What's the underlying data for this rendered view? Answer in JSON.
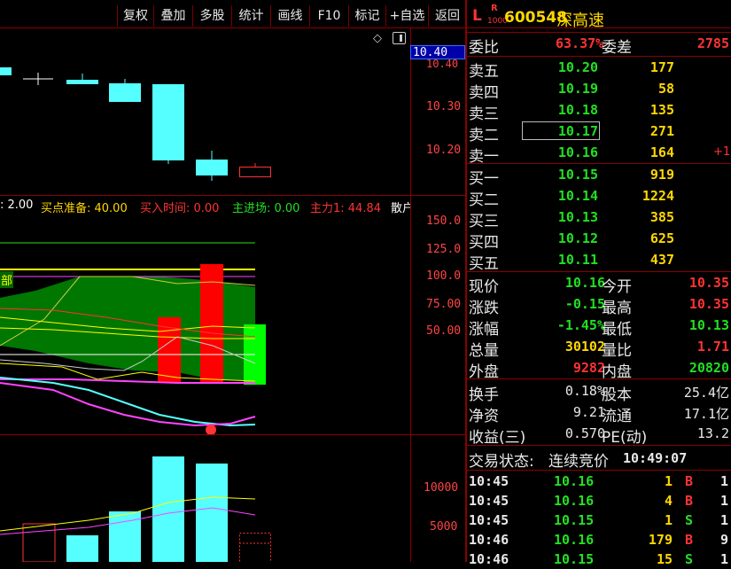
{
  "toolbar": [
    "复权",
    "叠加",
    "多股",
    "统计",
    "画线",
    "F10",
    "标记",
    "+自选",
    "返回"
  ],
  "price_axis": {
    "current": "10.40",
    "ticks": [
      "10.40",
      "10.30",
      "10.20"
    ]
  },
  "indicator_bar": [
    {
      "text": ": 2.00",
      "color": "#ffffff"
    },
    {
      "text": "买点准备: 40.00",
      "color": "#ffd700"
    },
    {
      "text": "买入时间: 0.00",
      "color": "#ff3333"
    },
    {
      "text": "主进场: 0.00",
      "color": "#22e022"
    },
    {
      "text": "主力1: 44.84",
      "color": "#ff3333"
    },
    {
      "text": "散户",
      "color": "#ffffff"
    }
  ],
  "indicator_axis": [
    "150.0",
    "125.0",
    "100.0",
    "75.00",
    "50.00"
  ],
  "indicator_label": "部",
  "volume_axis": [
    "10000",
    "5000"
  ],
  "stock": {
    "L": "L",
    "R": "R",
    "sub": "1000",
    "code": "600548",
    "name": "深高速"
  },
  "commission": {
    "ratio_label": "委比",
    "ratio": "63.37%",
    "diff_label": "委差",
    "diff": "2785"
  },
  "sells": [
    {
      "label": "卖五",
      "price": "10.20",
      "vol": "177",
      "extra": ""
    },
    {
      "label": "卖四",
      "price": "10.19",
      "vol": "58",
      "extra": ""
    },
    {
      "label": "卖三",
      "price": "10.18",
      "vol": "135",
      "extra": ""
    },
    {
      "label": "卖二",
      "price": "10.17",
      "vol": "271",
      "extra": ""
    },
    {
      "label": "卖一",
      "price": "10.16",
      "vol": "164",
      "extra": "+1"
    }
  ],
  "buys": [
    {
      "label": "买一",
      "price": "10.15",
      "vol": "919"
    },
    {
      "label": "买二",
      "price": "10.14",
      "vol": "1224"
    },
    {
      "label": "买三",
      "price": "10.13",
      "vol": "385"
    },
    {
      "label": "买四",
      "price": "10.12",
      "vol": "625"
    },
    {
      "label": "买五",
      "price": "10.11",
      "vol": "437"
    }
  ],
  "stats": [
    {
      "l1": "现价",
      "v1": "10.16",
      "c1": "#22e022",
      "l2": "今开",
      "v2": "10.35",
      "c2": "#ff3333"
    },
    {
      "l1": "涨跌",
      "v1": "-0.15",
      "c1": "#22e022",
      "l2": "最高",
      "v2": "10.35",
      "c2": "#ff3333"
    },
    {
      "l1": "涨幅",
      "v1": "-1.45%",
      "c1": "#22e022",
      "l2": "最低",
      "v2": "10.13",
      "c2": "#22e022"
    },
    {
      "l1": "总量",
      "v1": "30102",
      "c1": "#ffd700",
      "l2": "量比",
      "v2": "1.71",
      "c2": "#ff3333"
    },
    {
      "l1": "外盘",
      "v1": "9282",
      "c1": "#ff3333",
      "l2": "内盘",
      "v2": "20820",
      "c2": "#22e022"
    }
  ],
  "stats2": [
    {
      "l1": "换手",
      "v1": "0.18%",
      "l2": "股本",
      "v2": "25.4亿"
    },
    {
      "l1": "净资",
      "v1": "9.21",
      "l2": "流通",
      "v2": "17.1亿"
    },
    {
      "l1": "收益(三)",
      "v1": "0.570",
      "l2": "PE(动)",
      "v2": "13.2"
    }
  ],
  "trade_status": {
    "label": "交易状态:",
    "value": "连续竞价",
    "time": "10:49:07"
  },
  "ticks": [
    {
      "time": "10:45",
      "price": "10.16",
      "vol": "1",
      "flag": "B",
      "num": "1"
    },
    {
      "time": "10:45",
      "price": "10.16",
      "vol": "4",
      "flag": "B",
      "num": "1"
    },
    {
      "time": "10:45",
      "price": "10.15",
      "vol": "1",
      "flag": "S",
      "num": "1"
    },
    {
      "time": "10:46",
      "price": "10.16",
      "vol": "179",
      "flag": "B",
      "num": "9"
    },
    {
      "time": "10:46",
      "price": "10.15",
      "vol": "15",
      "flag": "S",
      "num": "1"
    }
  ]
}
